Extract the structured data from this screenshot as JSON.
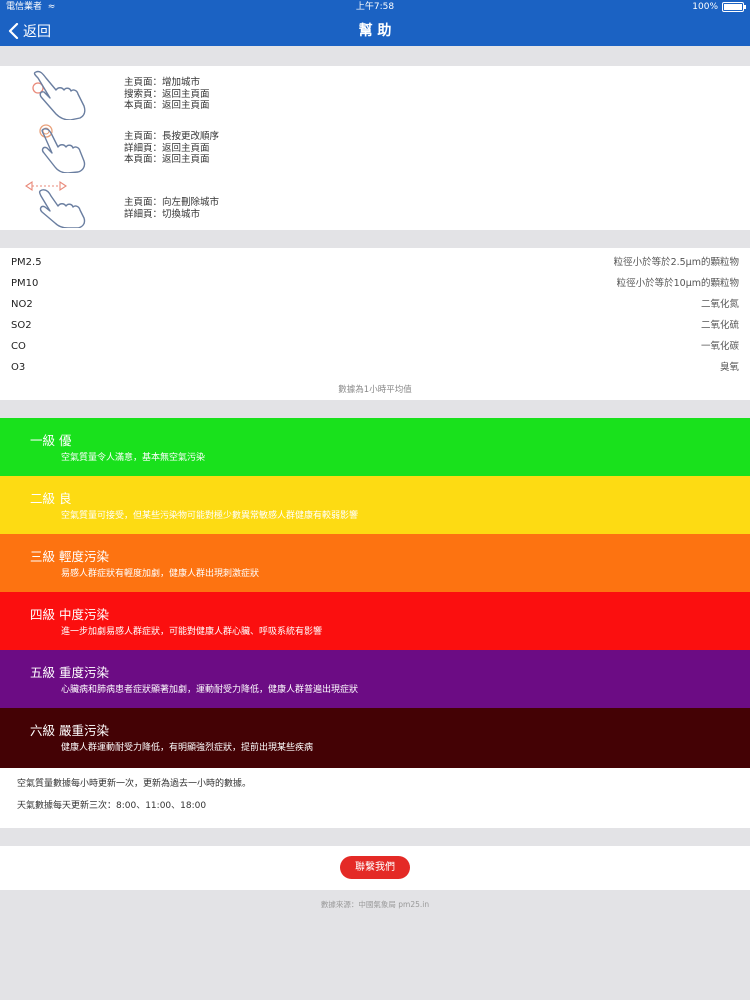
{
  "status_bar": {
    "carrier": "電信業者",
    "time": "上午7:58",
    "battery": "100%"
  },
  "nav": {
    "back_label": "返回",
    "title": "幫 助"
  },
  "gestures": [
    {
      "icon": "tap-gesture-icon",
      "lines": [
        "主頁面：增加城市",
        "搜索頁：返回主頁面",
        "本頁面：返回主頁面"
      ]
    },
    {
      "icon": "long-press-gesture-icon",
      "lines": [
        "主頁面：長按更改順序",
        "詳細頁：返回主頁面",
        "本頁面：返回主頁面"
      ]
    },
    {
      "icon": "swipe-gesture-icon",
      "lines": [
        "主頁面：向左刪除城市",
        "詳細頁：切換城市"
      ]
    }
  ],
  "pollutants": [
    {
      "name": "PM2.5",
      "desc": "粒徑小於等於2.5μm的顆粒物"
    },
    {
      "name": "PM10",
      "desc": "粒徑小於等於10μm的顆粒物"
    },
    {
      "name": "NO2",
      "desc": "二氧化氮"
    },
    {
      "name": "SO2",
      "desc": "二氧化硫"
    },
    {
      "name": "CO",
      "desc": "一氧化碳"
    },
    {
      "name": "O3",
      "desc": "臭氧"
    }
  ],
  "pollutant_note": "數據為1小時平均值",
  "levels": [
    {
      "title": "一級  優",
      "desc": "空氣質量令人滿意，基本無空氣污染",
      "color": "#19e11c"
    },
    {
      "title": "二級  良",
      "desc": "空氣質量可接受，但某些污染物可能對極少數異常敏感人群健康有較弱影響",
      "color": "#fddb13"
    },
    {
      "title": "三級  輕度污染",
      "desc": "易感人群症狀有輕度加劇，健康人群出現刺激症狀",
      "color": "#fd7311"
    },
    {
      "title": "四級  中度污染",
      "desc": "進一步加劇易感人群症狀，可能對健康人群心臟、呼吸系統有影響",
      "color": "#fb0f0f"
    },
    {
      "title": "五級  重度污染",
      "desc": "心臟病和肺病患者症狀顯著加劇，運動耐受力降低，健康人群普遍出現症狀",
      "color": "#6c0c84"
    },
    {
      "title": "六級  嚴重污染",
      "desc": "健康人群運動耐受力降低，有明顯強烈症狀，提前出現某些疾病",
      "color": "#440205"
    }
  ],
  "update_info": {
    "air": "空氣質量數據每小時更新一次，更新為過去一小時的數據。",
    "weather": "天氣數據每天更新三次：8:00、11:00、18:00"
  },
  "contact_label": "聯繫我們",
  "source_text": "數據來源：中國氣象局 pm25.in"
}
